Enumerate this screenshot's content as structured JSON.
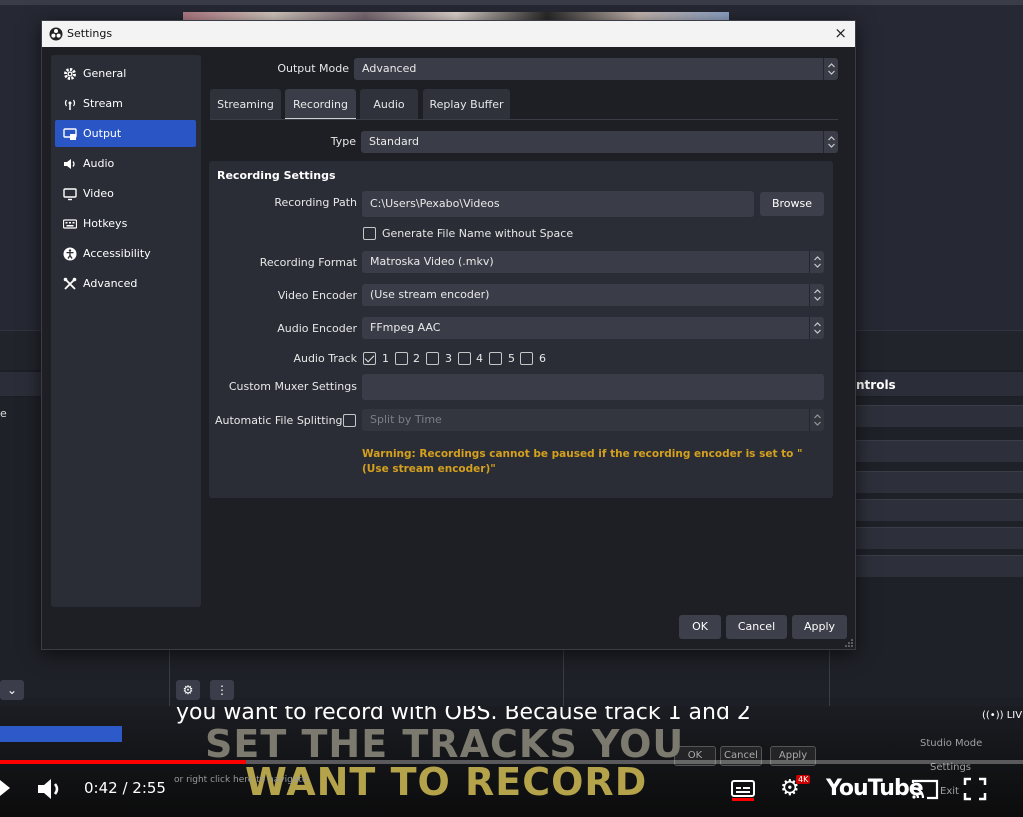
{
  "dialog": {
    "title": "Settings",
    "close": "×"
  },
  "sidebar": {
    "items": [
      {
        "label": "General",
        "icon": "gear-icon"
      },
      {
        "label": "Stream",
        "icon": "broadcast-icon"
      },
      {
        "label": "Output",
        "icon": "output-icon"
      },
      {
        "label": "Audio",
        "icon": "speaker-icon"
      },
      {
        "label": "Video",
        "icon": "monitor-icon"
      },
      {
        "label": "Hotkeys",
        "icon": "keyboard-icon"
      },
      {
        "label": "Accessibility",
        "icon": "accessibility-icon"
      },
      {
        "label": "Advanced",
        "icon": "tools-icon"
      }
    ],
    "active": "Output"
  },
  "output": {
    "mode_label": "Output Mode",
    "mode_value": "Advanced",
    "tabs": [
      "Streaming",
      "Recording",
      "Audio",
      "Replay Buffer"
    ],
    "active_tab": "Recording",
    "type_label": "Type",
    "type_value": "Standard"
  },
  "recording": {
    "title": "Recording Settings",
    "path_label": "Recording Path",
    "path_value": "C:\\Users\\Pexabo\\Videos",
    "browse": "Browse",
    "gen_name_label": "Generate File Name without Space",
    "format_label": "Recording Format",
    "format_value": "Matroska Video (.mkv)",
    "video_enc_label": "Video Encoder",
    "video_enc_value": "(Use stream encoder)",
    "audio_enc_label": "Audio Encoder",
    "audio_enc_value": "FFmpeg AAC",
    "audio_track_label": "Audio Track",
    "tracks": [
      {
        "label": "1",
        "checked": true
      },
      {
        "label": "2",
        "checked": false
      },
      {
        "label": "3",
        "checked": false
      },
      {
        "label": "4",
        "checked": false
      },
      {
        "label": "5",
        "checked": false
      },
      {
        "label": "6",
        "checked": false
      }
    ],
    "muxer_label": "Custom Muxer Settings",
    "muxer_value": "",
    "split_label": "Automatic File Splitting",
    "split_value": "Split by Time",
    "warning": "Warning: Recordings cannot be paused if the recording encoder is set to \"(Use stream encoder)\""
  },
  "footer": {
    "ok": "OK",
    "cancel": "Cancel",
    "apply": "Apply"
  },
  "background": {
    "controls_title": "ntrols",
    "scene_fragment": "e",
    "studio_mode": "Studio Mode",
    "settings": "Settings",
    "exit": "Exit",
    "ok": "OK",
    "cancel": "Cancel",
    "apply": "Apply"
  },
  "video": {
    "caption_small": "you want to record with OBS. Because track 1 and 2",
    "caption_big_1": "SET THE TRACKS YOU",
    "caption_big_2": "WANT TO RECORD",
    "time": "0:42 / 2:55",
    "hint": "or right click here to navigate.",
    "logo": "YouTube",
    "live": "LIVE",
    "quality_badge": "4K",
    "progress": 0.24
  },
  "colors": {
    "accent": "#2a55c4",
    "warning": "#d4a01d",
    "progress": "#ff0000"
  }
}
